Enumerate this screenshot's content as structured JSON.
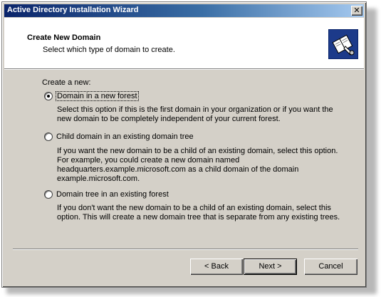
{
  "window": {
    "title": "Active Directory Installation Wizard",
    "close_glyph": "✕"
  },
  "header": {
    "title": "Create New Domain",
    "subtitle": "Select which type of domain to create.",
    "icon": "ad-wizard-book-icon"
  },
  "form": {
    "group_label": "Create a new:",
    "options": [
      {
        "label": "Domain in a new forest",
        "selected": true,
        "description": "Select this option if this is the first domain in your organization or if you want the new domain to be completely independent of your current forest."
      },
      {
        "label": "Child domain in an existing domain tree",
        "selected": false,
        "description": "If you want the new domain to be a child of an existing domain, select this option. For example, you could create a new domain named headquarters.example.microsoft.com as a child domain of the domain example.microsoft.com."
      },
      {
        "label": "Domain tree in an existing forest",
        "selected": false,
        "description": "If you don't want the new domain to be a child of an existing domain, select this option. This will create a new domain tree that is separate from any existing trees."
      }
    ]
  },
  "buttons": {
    "back": "< Back",
    "next": "Next >",
    "cancel": "Cancel"
  },
  "colors": {
    "titlebar_start": "#0a246a",
    "titlebar_end": "#a6caf0",
    "face": "#d4d0c8"
  }
}
